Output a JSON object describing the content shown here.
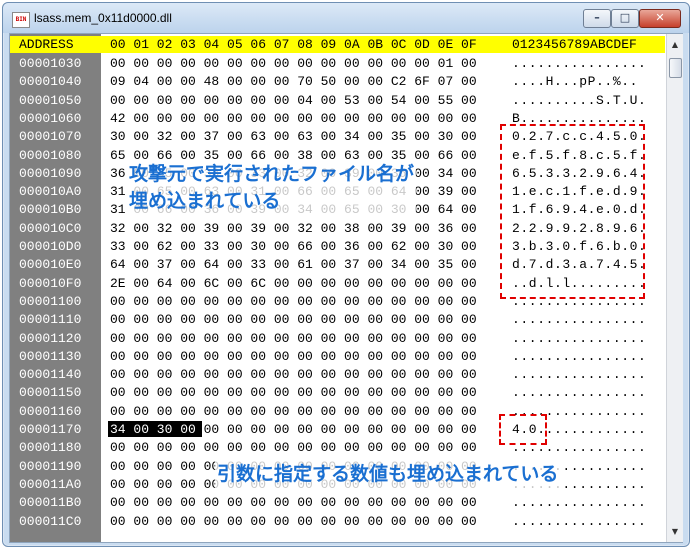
{
  "window": {
    "title": "lsass.mem_0x11d0000.dll",
    "icon_label": "BIN",
    "minimize_label": "–",
    "maximize_label": "□",
    "close_label": "✕"
  },
  "header": {
    "address": "ADDRESS",
    "bytes": "00 01 02 03 04 05 06 07 08 09 0A 0B 0C 0D 0E 0F",
    "ascii": "0123456789ABCDEF"
  },
  "rows": [
    {
      "addr": "00001030",
      "hex": "00 00 00 00 00 00 00 00 00 00 00 00 00 00 01 00",
      "ascii": "................"
    },
    {
      "addr": "00001040",
      "hex": "09 04 00 00 48 00 00 00 70 50 00 00 C2 6F 07 00",
      "ascii": "....H...pP..%.."
    },
    {
      "addr": "00001050",
      "hex": "00 00 00 00 00 00 00 00 04 00 53 00 54 00 55 00",
      "ascii": "..........S.T.U."
    },
    {
      "addr": "00001060",
      "hex": "42 00 00 00 00 00 00 00 00 00 00 00 00 00 00 00",
      "ascii": "B..............."
    },
    {
      "addr": "00001070",
      "hex": "30 00 32 00 37 00 63 00 63 00 34 00 35 00 30 00",
      "ascii": "0.2.7.c.c.4.5.0."
    },
    {
      "addr": "00001080",
      "hex": "65 00 66 00 35 00 66 00 38 00 63 00 35 00 66 00",
      "ascii": "e.f.5.f.8.c.5.f."
    },
    {
      "addr": "00001090",
      "hex": "36 00 35 00 33 00 33 00 32 00 39 00 36 00 34 00",
      "ascii": "6.5.3.3.2.9.6.4."
    },
    {
      "addr": "000010A0",
      "hex": "31 00 65 00 63 00 31 00 66 00 65 00 64 00 39 00",
      "ascii": "1.e.c.1.f.e.d.9."
    },
    {
      "addr": "000010B0",
      "hex": "31 00 66 00 36 00 39 00 34 00 65 00 30 00 64 00",
      "ascii": "1.f.6.9.4.e.0.d."
    },
    {
      "addr": "000010C0",
      "hex": "32 00 32 00 39 00 39 00 32 00 38 00 39 00 36 00",
      "ascii": "2.2.9.9.2.8.9.6."
    },
    {
      "addr": "000010D0",
      "hex": "33 00 62 00 33 00 30 00 66 00 36 00 62 00 30 00",
      "ascii": "3.b.3.0.f.6.b.0."
    },
    {
      "addr": "000010E0",
      "hex": "64 00 37 00 64 00 33 00 61 00 37 00 34 00 35 00",
      "ascii": "d.7.d.3.a.7.4.5."
    },
    {
      "addr": "000010F0",
      "hex": "2E 00 64 00 6C 00 6C 00 00 00 00 00 00 00 00 00",
      "ascii": "..d.l.l........."
    },
    {
      "addr": "00001100",
      "hex": "00 00 00 00 00 00 00 00 00 00 00 00 00 00 00 00",
      "ascii": "................"
    },
    {
      "addr": "00001110",
      "hex": "00 00 00 00 00 00 00 00 00 00 00 00 00 00 00 00",
      "ascii": "................"
    },
    {
      "addr": "00001120",
      "hex": "00 00 00 00 00 00 00 00 00 00 00 00 00 00 00 00",
      "ascii": "................"
    },
    {
      "addr": "00001130",
      "hex": "00 00 00 00 00 00 00 00 00 00 00 00 00 00 00 00",
      "ascii": "................"
    },
    {
      "addr": "00001140",
      "hex": "00 00 00 00 00 00 00 00 00 00 00 00 00 00 00 00",
      "ascii": "................"
    },
    {
      "addr": "00001150",
      "hex": "00 00 00 00 00 00 00 00 00 00 00 00 00 00 00 00",
      "ascii": "................"
    },
    {
      "addr": "00001160",
      "hex": "00 00 00 00 00 00 00 00 00 00 00 00 00 00 00 00",
      "ascii": "................"
    },
    {
      "addr": "00001170",
      "hex": "34 00 30 00 00 00 00 00 00 00 00 00 00 00 00 00",
      "ascii": "4.0............."
    },
    {
      "addr": "00001180",
      "hex": "00 00 00 00 00 00 00 00 00 00 00 00 00 00 00 00",
      "ascii": "................"
    },
    {
      "addr": "00001190",
      "hex": "00 00 00 00 00 00 00 00 00 00 00 00 00 00 00 00",
      "ascii": "................"
    },
    {
      "addr": "000011A0",
      "hex": "00 00 00 00 00 00 00 00 00 00 00 00 00 00 00 00",
      "ascii": "................"
    },
    {
      "addr": "000011B0",
      "hex": "00 00 00 00 00 00 00 00 00 00 00 00 00 00 00 00",
      "ascii": "................"
    },
    {
      "addr": "000011C0",
      "hex": "00 00 00 00 00 00 00 00 00 00 00 00 00 00 00 00",
      "ascii": "................"
    }
  ],
  "selection": {
    "addr": "00001170",
    "hex": "34 00 30 00"
  },
  "annotations": {
    "filename_note": "攻撃元で実行されたファイル名が\n埋め込まれている",
    "args_note": "引数に指定する数値も埋め込まれている"
  },
  "colors": {
    "header_bg": "#ffff00",
    "address_column_bg": "#808080",
    "annotation_text": "#1a6fd1",
    "highlight_box": "#e00000",
    "selection_bg": "#000000"
  }
}
